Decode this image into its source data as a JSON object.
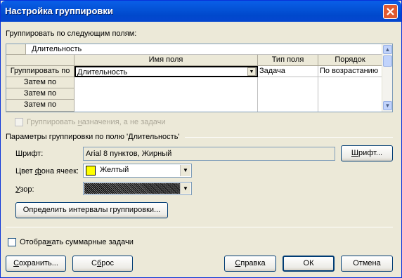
{
  "window": {
    "title": "Настройка группировки"
  },
  "group_fields_label": "Группировать по следующим полям:",
  "grid": {
    "top_cell": "Длительность",
    "columns": [
      "Имя поля",
      "Тип поля",
      "Порядок"
    ],
    "row_labels": [
      "Группировать по",
      "Затем по",
      "Затем по",
      "Затем по"
    ],
    "rows": [
      {
        "name": "Длительность",
        "type": "Задача",
        "order": "По возрастанию"
      },
      {
        "name": "",
        "type": "",
        "order": ""
      },
      {
        "name": "",
        "type": "",
        "order": ""
      },
      {
        "name": "",
        "type": "",
        "order": ""
      }
    ]
  },
  "group_assignments": {
    "label_pre": "Группировать ",
    "label_u": "н",
    "label_post": "азначения, а не задачи",
    "checked": false
  },
  "params": {
    "title": "Параметры группировки по полю 'Длительность'",
    "font_label": "Шрифт:",
    "font_value": "Arial 8 пунктов, Жирный",
    "font_button_u": "Ш",
    "font_button_rest": "рифт...",
    "cell_bg_pre": "Цвет ",
    "cell_bg_u": "ф",
    "cell_bg_post": "она ячеек:",
    "cell_bg_value": "Желтый",
    "cell_bg_color": "#ffff00",
    "pattern_u": "У",
    "pattern_rest": "зор:",
    "intervals_button": "Определить интервалы группировки..."
  },
  "show_summary": {
    "label_pre": "Отобра",
    "label_u": "ж",
    "label_post": "ать суммарные задачи",
    "checked": false
  },
  "buttons": {
    "save_pre": "",
    "save_u": "С",
    "save_post": "охранить...",
    "reset_pre": "С",
    "reset_u": "б",
    "reset_post": "рос",
    "help_pre": "",
    "help_u": "С",
    "help_post": "правка",
    "ok": "ОК",
    "cancel": "Отмена"
  }
}
